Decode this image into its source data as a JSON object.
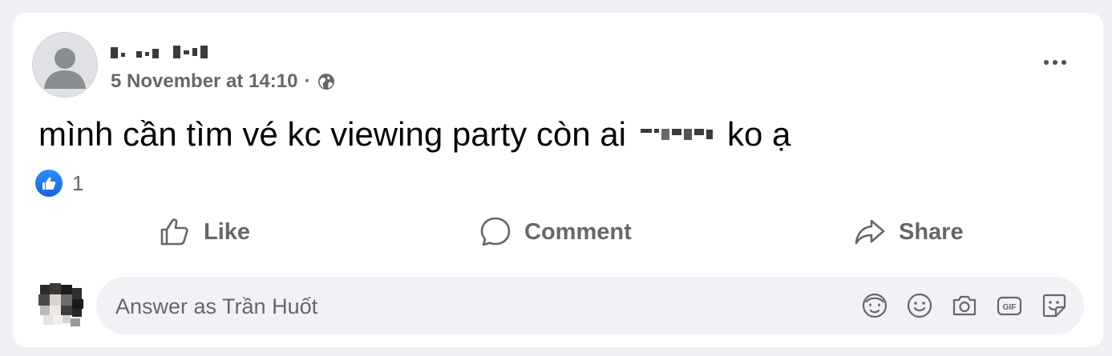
{
  "post": {
    "timestamp": "5 November at 14:10",
    "separator": "·",
    "audience_icon": "globe-icon",
    "text_before": "mình cần tìm vé kc viewing party còn ai",
    "text_after": "ko ạ",
    "reaction_count": "1",
    "reaction_icon": "like-reaction-icon"
  },
  "actions": {
    "like_label": "Like",
    "comment_label": "Comment",
    "share_label": "Share"
  },
  "composer": {
    "placeholder": "Answer as Trần Huốt",
    "tools": [
      "avatar-sticker-icon",
      "emoji-icon",
      "camera-icon",
      "gif-icon",
      "sticker-icon"
    ]
  },
  "colors": {
    "background": "#eef0f3",
    "card": "#ffffff",
    "secondary_text": "#65676b",
    "primary_text": "#050505",
    "like_blue": "#1877f2",
    "input_bg": "#f0f2f5"
  }
}
